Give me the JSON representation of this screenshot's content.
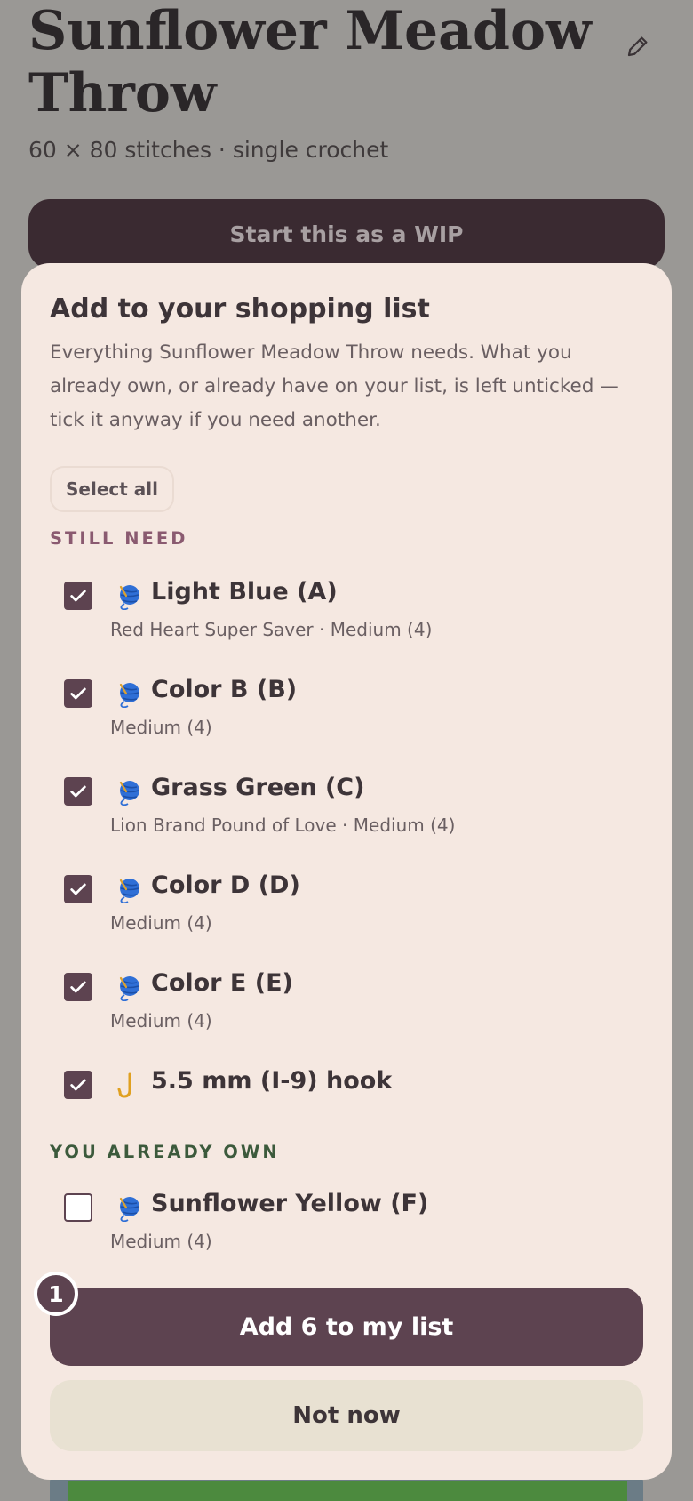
{
  "pattern": {
    "title": "Sunflower Meadow Throw",
    "subtitle": "60 × 80 stitches · single crochet",
    "start_wip_label": "Start this as a WIP"
  },
  "sheet": {
    "title": "Add to your shopping list",
    "description": "Everything Sunflower Meadow Throw needs. What you already own, or already have on your list, is left unticked — tick it anyway if you need another.",
    "select_all_label": "Select all",
    "still_need_heading": "STILL NEED",
    "already_own_heading": "YOU ALREADY OWN",
    "still_need_items": [
      {
        "name": "Light Blue (A)",
        "detail": "Red Heart Super Saver · Medium (4)",
        "icon": "yarn-ball-icon",
        "checked": true
      },
      {
        "name": "Color B (B)",
        "detail": "Medium (4)",
        "icon": "yarn-ball-icon",
        "checked": true
      },
      {
        "name": "Grass Green (C)",
        "detail": "Lion Brand Pound of Love · Medium (4)",
        "icon": "yarn-ball-icon",
        "checked": true
      },
      {
        "name": "Color D (D)",
        "detail": "Medium (4)",
        "icon": "yarn-ball-icon",
        "checked": true
      },
      {
        "name": "Color E (E)",
        "detail": "Medium (4)",
        "icon": "yarn-ball-icon",
        "checked": true
      },
      {
        "name": "5.5 mm (I-9) hook",
        "detail": "",
        "icon": "hook-icon",
        "checked": true
      }
    ],
    "already_own_items": [
      {
        "name": "Sunflower Yellow (F)",
        "detail": "Medium (4)",
        "icon": "yarn-ball-icon",
        "checked": false
      }
    ],
    "add_button_label": "Add 6 to my list",
    "badge_count": "1",
    "not_now_label": "Not now"
  },
  "colors": {
    "accent": "#5d4350",
    "sheet_bg": "#f5e8e1",
    "still_need_heading": "#8a5a70",
    "already_own_heading": "#3c5a3c"
  }
}
